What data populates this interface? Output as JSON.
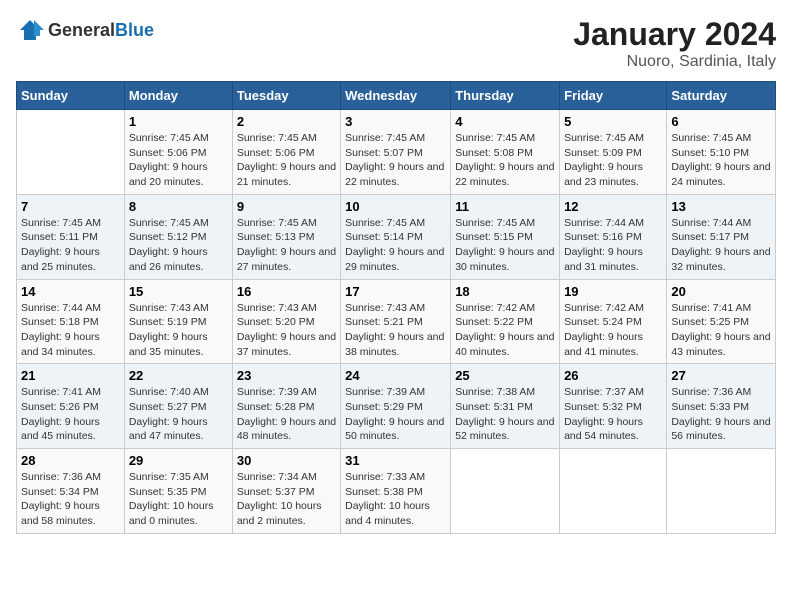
{
  "logo": {
    "general": "General",
    "blue": "Blue"
  },
  "title": "January 2024",
  "subtitle": "Nuoro, Sardinia, Italy",
  "days_of_week": [
    "Sunday",
    "Monday",
    "Tuesday",
    "Wednesday",
    "Thursday",
    "Friday",
    "Saturday"
  ],
  "weeks": [
    [
      {
        "day": "",
        "sunrise": "",
        "sunset": "",
        "daylight": ""
      },
      {
        "day": "1",
        "sunrise": "Sunrise: 7:45 AM",
        "sunset": "Sunset: 5:06 PM",
        "daylight": "Daylight: 9 hours and 20 minutes."
      },
      {
        "day": "2",
        "sunrise": "Sunrise: 7:45 AM",
        "sunset": "Sunset: 5:06 PM",
        "daylight": "Daylight: 9 hours and 21 minutes."
      },
      {
        "day": "3",
        "sunrise": "Sunrise: 7:45 AM",
        "sunset": "Sunset: 5:07 PM",
        "daylight": "Daylight: 9 hours and 22 minutes."
      },
      {
        "day": "4",
        "sunrise": "Sunrise: 7:45 AM",
        "sunset": "Sunset: 5:08 PM",
        "daylight": "Daylight: 9 hours and 22 minutes."
      },
      {
        "day": "5",
        "sunrise": "Sunrise: 7:45 AM",
        "sunset": "Sunset: 5:09 PM",
        "daylight": "Daylight: 9 hours and 23 minutes."
      },
      {
        "day": "6",
        "sunrise": "Sunrise: 7:45 AM",
        "sunset": "Sunset: 5:10 PM",
        "daylight": "Daylight: 9 hours and 24 minutes."
      }
    ],
    [
      {
        "day": "7",
        "sunrise": "Sunrise: 7:45 AM",
        "sunset": "Sunset: 5:11 PM",
        "daylight": "Daylight: 9 hours and 25 minutes."
      },
      {
        "day": "8",
        "sunrise": "Sunrise: 7:45 AM",
        "sunset": "Sunset: 5:12 PM",
        "daylight": "Daylight: 9 hours and 26 minutes."
      },
      {
        "day": "9",
        "sunrise": "Sunrise: 7:45 AM",
        "sunset": "Sunset: 5:13 PM",
        "daylight": "Daylight: 9 hours and 27 minutes."
      },
      {
        "day": "10",
        "sunrise": "Sunrise: 7:45 AM",
        "sunset": "Sunset: 5:14 PM",
        "daylight": "Daylight: 9 hours and 29 minutes."
      },
      {
        "day": "11",
        "sunrise": "Sunrise: 7:45 AM",
        "sunset": "Sunset: 5:15 PM",
        "daylight": "Daylight: 9 hours and 30 minutes."
      },
      {
        "day": "12",
        "sunrise": "Sunrise: 7:44 AM",
        "sunset": "Sunset: 5:16 PM",
        "daylight": "Daylight: 9 hours and 31 minutes."
      },
      {
        "day": "13",
        "sunrise": "Sunrise: 7:44 AM",
        "sunset": "Sunset: 5:17 PM",
        "daylight": "Daylight: 9 hours and 32 minutes."
      }
    ],
    [
      {
        "day": "14",
        "sunrise": "Sunrise: 7:44 AM",
        "sunset": "Sunset: 5:18 PM",
        "daylight": "Daylight: 9 hours and 34 minutes."
      },
      {
        "day": "15",
        "sunrise": "Sunrise: 7:43 AM",
        "sunset": "Sunset: 5:19 PM",
        "daylight": "Daylight: 9 hours and 35 minutes."
      },
      {
        "day": "16",
        "sunrise": "Sunrise: 7:43 AM",
        "sunset": "Sunset: 5:20 PM",
        "daylight": "Daylight: 9 hours and 37 minutes."
      },
      {
        "day": "17",
        "sunrise": "Sunrise: 7:43 AM",
        "sunset": "Sunset: 5:21 PM",
        "daylight": "Daylight: 9 hours and 38 minutes."
      },
      {
        "day": "18",
        "sunrise": "Sunrise: 7:42 AM",
        "sunset": "Sunset: 5:22 PM",
        "daylight": "Daylight: 9 hours and 40 minutes."
      },
      {
        "day": "19",
        "sunrise": "Sunrise: 7:42 AM",
        "sunset": "Sunset: 5:24 PM",
        "daylight": "Daylight: 9 hours and 41 minutes."
      },
      {
        "day": "20",
        "sunrise": "Sunrise: 7:41 AM",
        "sunset": "Sunset: 5:25 PM",
        "daylight": "Daylight: 9 hours and 43 minutes."
      }
    ],
    [
      {
        "day": "21",
        "sunrise": "Sunrise: 7:41 AM",
        "sunset": "Sunset: 5:26 PM",
        "daylight": "Daylight: 9 hours and 45 minutes."
      },
      {
        "day": "22",
        "sunrise": "Sunrise: 7:40 AM",
        "sunset": "Sunset: 5:27 PM",
        "daylight": "Daylight: 9 hours and 47 minutes."
      },
      {
        "day": "23",
        "sunrise": "Sunrise: 7:39 AM",
        "sunset": "Sunset: 5:28 PM",
        "daylight": "Daylight: 9 hours and 48 minutes."
      },
      {
        "day": "24",
        "sunrise": "Sunrise: 7:39 AM",
        "sunset": "Sunset: 5:29 PM",
        "daylight": "Daylight: 9 hours and 50 minutes."
      },
      {
        "day": "25",
        "sunrise": "Sunrise: 7:38 AM",
        "sunset": "Sunset: 5:31 PM",
        "daylight": "Daylight: 9 hours and 52 minutes."
      },
      {
        "day": "26",
        "sunrise": "Sunrise: 7:37 AM",
        "sunset": "Sunset: 5:32 PM",
        "daylight": "Daylight: 9 hours and 54 minutes."
      },
      {
        "day": "27",
        "sunrise": "Sunrise: 7:36 AM",
        "sunset": "Sunset: 5:33 PM",
        "daylight": "Daylight: 9 hours and 56 minutes."
      }
    ],
    [
      {
        "day": "28",
        "sunrise": "Sunrise: 7:36 AM",
        "sunset": "Sunset: 5:34 PM",
        "daylight": "Daylight: 9 hours and 58 minutes."
      },
      {
        "day": "29",
        "sunrise": "Sunrise: 7:35 AM",
        "sunset": "Sunset: 5:35 PM",
        "daylight": "Daylight: 10 hours and 0 minutes."
      },
      {
        "day": "30",
        "sunrise": "Sunrise: 7:34 AM",
        "sunset": "Sunset: 5:37 PM",
        "daylight": "Daylight: 10 hours and 2 minutes."
      },
      {
        "day": "31",
        "sunrise": "Sunrise: 7:33 AM",
        "sunset": "Sunset: 5:38 PM",
        "daylight": "Daylight: 10 hours and 4 minutes."
      },
      {
        "day": "",
        "sunrise": "",
        "sunset": "",
        "daylight": ""
      },
      {
        "day": "",
        "sunrise": "",
        "sunset": "",
        "daylight": ""
      },
      {
        "day": "",
        "sunrise": "",
        "sunset": "",
        "daylight": ""
      }
    ]
  ]
}
